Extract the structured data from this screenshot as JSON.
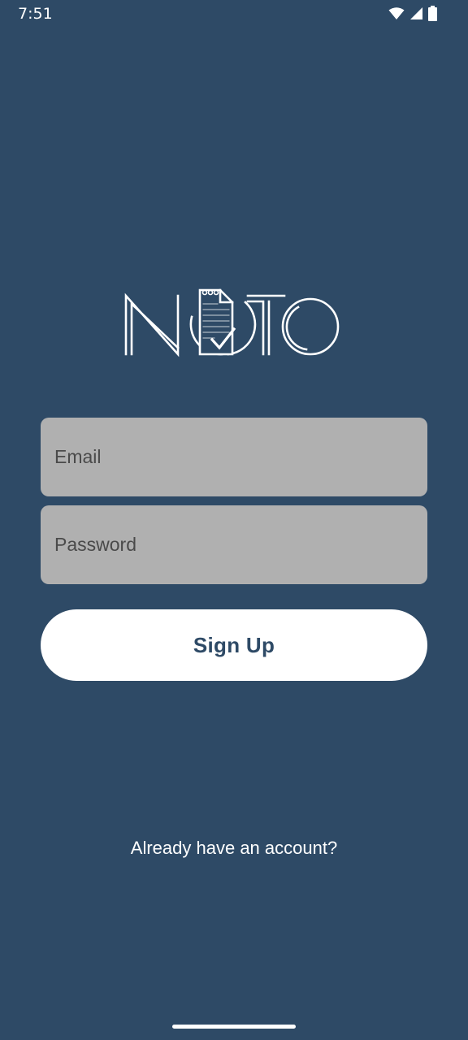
{
  "status_bar": {
    "time": "7:51",
    "icons": [
      "wifi-icon",
      "signal-icon",
      "battery-icon"
    ]
  },
  "logo": {
    "text": "NOTO",
    "icon": "note-checklist-icon"
  },
  "form": {
    "email_placeholder": "Email",
    "email_value": "",
    "password_placeholder": "Password",
    "password_value": ""
  },
  "actions": {
    "signup_label": "Sign Up",
    "login_link": "Already have an account?"
  },
  "colors": {
    "background": "#2e4a66",
    "field": "#b0b0b0",
    "button": "#ffffff",
    "button_text": "#2e4a66"
  }
}
